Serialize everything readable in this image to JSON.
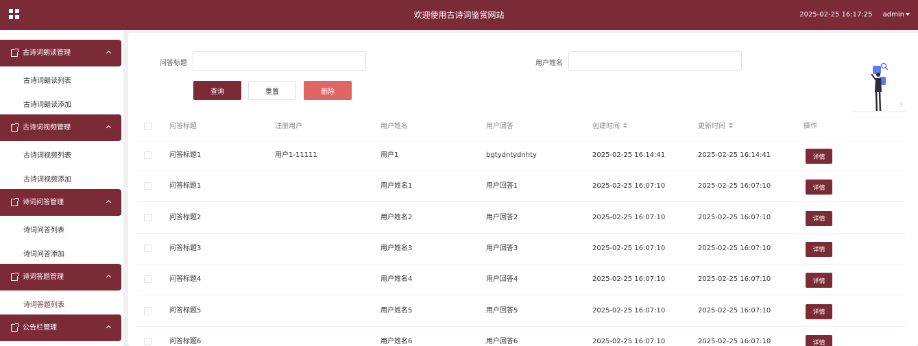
{
  "header": {
    "title": "欢迎使用古诗词鉴赏网站",
    "datetime": "2025-02-25 16:17:25",
    "user": "admin",
    "menu_icon": "grid-icon",
    "accent_color": "#7a2b35"
  },
  "sidebar": {
    "groups": [
      {
        "title": "古诗词朗读管理",
        "items": [
          "古诗词朗读列表",
          "古诗词朗读添加"
        ]
      },
      {
        "title": "古诗词视频管理",
        "items": [
          "古诗词视频列表",
          "古诗词视频添加"
        ]
      },
      {
        "title": "诗词问答管理",
        "items": [
          "诗词问答列表",
          "诗词问答添加"
        ]
      },
      {
        "title": "诗词答题管理",
        "items": [
          "诗词答题列表"
        ]
      },
      {
        "title": "公告栏管理",
        "items": []
      }
    ]
  },
  "search": {
    "title_label": "问答标题",
    "title_value": "",
    "name_label": "用户姓名",
    "name_value": "",
    "query_button": "查询",
    "reset_button": "重置",
    "delete_button": "删除"
  },
  "table": {
    "columns": [
      "问答标题",
      "注册用户",
      "用户姓名",
      "用户回答",
      "创建时间",
      "更新时间",
      "操作"
    ],
    "action_label": "详情",
    "rows": [
      [
        "问答标题1",
        "用户1-11111",
        "用户1",
        "bgtydntydnhty",
        "2025-02-25 16:14:41",
        "2025-02-25 16:14:41"
      ],
      [
        "问答标题1",
        "",
        "用户姓名1",
        "用户回答1",
        "2025-02-25 16:07:10",
        "2025-02-25 16:07:10"
      ],
      [
        "问答标题2",
        "",
        "用户姓名2",
        "用户回答2",
        "2025-02-25 16:07:10",
        "2025-02-25 16:07:10"
      ],
      [
        "问答标题3",
        "",
        "用户姓名3",
        "用户回答3",
        "2025-02-25 16:07:10",
        "2025-02-25 16:07:10"
      ],
      [
        "问答标题4",
        "",
        "用户姓名4",
        "用户回答4",
        "2025-02-25 16:07:10",
        "2025-02-25 16:07:10"
      ],
      [
        "问答标题5",
        "",
        "用户姓名5",
        "用户回答5",
        "2025-02-25 16:07:10",
        "2025-02-25 16:07:10"
      ],
      [
        "问答标题6",
        "",
        "用户姓名6",
        "用户回答6",
        "2025-02-25 16:07:10",
        "2025-02-25 16:07:10"
      ]
    ]
  }
}
